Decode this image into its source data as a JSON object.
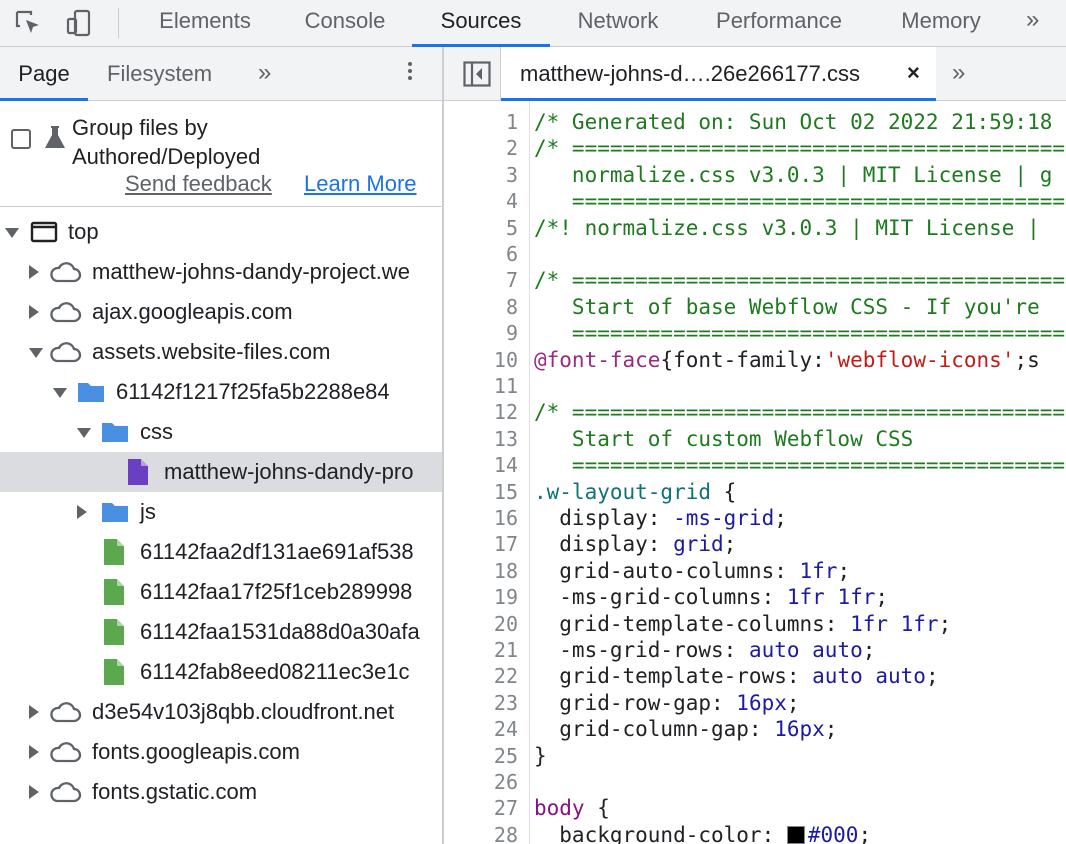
{
  "toolbar": {
    "tabs": [
      "Elements",
      "Console",
      "Sources",
      "Network",
      "Performance",
      "Memory"
    ],
    "active_tab": "Sources",
    "overflow": "»"
  },
  "navigator": {
    "tabs": [
      "Page",
      "Filesystem"
    ],
    "active_tab": "Page",
    "overflow": "»",
    "group_files": {
      "checked": false,
      "label_line1": "Group files by",
      "label_line2": "Authored/Deployed",
      "send_feedback": "Send feedback",
      "learn_more": "Learn More"
    },
    "tree": [
      {
        "label": "top",
        "icon": "frame-icon",
        "arrow": "down",
        "indent": 0
      },
      {
        "label": "matthew-johns-dandy-project.we",
        "icon": "cloud-icon",
        "arrow": "right",
        "indent": 1
      },
      {
        "label": "ajax.googleapis.com",
        "icon": "cloud-icon",
        "arrow": "right",
        "indent": 1
      },
      {
        "label": "assets.website-files.com",
        "icon": "cloud-icon",
        "arrow": "down",
        "indent": 1
      },
      {
        "label": "61142f1217f25fa5b2288e84",
        "icon": "folder-icon",
        "arrow": "down",
        "indent": 2
      },
      {
        "label": "css",
        "icon": "folder-icon",
        "arrow": "down",
        "indent": 3
      },
      {
        "label": "matthew-johns-dandy-pro",
        "icon": "css-file-icon",
        "arrow": "none",
        "indent": 4,
        "selected": true
      },
      {
        "label": "js",
        "icon": "folder-icon",
        "arrow": "right",
        "indent": 3
      },
      {
        "label": "61142faa2df131ae691af538",
        "icon": "js-file-icon",
        "arrow": "none",
        "indent": 3
      },
      {
        "label": "61142faa17f25f1ceb289998",
        "icon": "js-file-icon",
        "arrow": "none",
        "indent": 3
      },
      {
        "label": "61142faa1531da88d0a30afa",
        "icon": "js-file-icon",
        "arrow": "none",
        "indent": 3
      },
      {
        "label": "61142fab8eed08211ec3e1c",
        "icon": "js-file-icon",
        "arrow": "none",
        "indent": 3
      },
      {
        "label": "d3e54v103j8qbb.cloudfront.net",
        "icon": "cloud-icon",
        "arrow": "right",
        "indent": 1
      },
      {
        "label": "fonts.googleapis.com",
        "icon": "cloud-icon",
        "arrow": "right",
        "indent": 1
      },
      {
        "label": "fonts.gstatic.com",
        "icon": "cloud-icon",
        "arrow": "right",
        "indent": 1
      }
    ]
  },
  "editor": {
    "file_tab": "matthew-johns-d….26e266177.css",
    "close": "×",
    "overflow": "»",
    "lines": [
      {
        "n": "1",
        "parts": [
          [
            "c-comment",
            "/* Generated on: Sun Oct 02 2022 21:59:18"
          ]
        ]
      },
      {
        "n": "2",
        "parts": [
          [
            "c-comment",
            "/* =========================================="
          ]
        ]
      },
      {
        "n": "3",
        "parts": [
          [
            "c-comment",
            "   normalize.css v3.0.3 | MIT License | g"
          ]
        ]
      },
      {
        "n": "4",
        "parts": [
          [
            "c-comment",
            "   =========================================="
          ]
        ]
      },
      {
        "n": "5",
        "parts": [
          [
            "c-comment",
            "/*! normalize.css v3.0.3 | MIT License |"
          ]
        ]
      },
      {
        "n": "6",
        "parts": []
      },
      {
        "n": "7",
        "parts": [
          [
            "c-comment",
            "/* =========================================="
          ]
        ]
      },
      {
        "n": "8",
        "parts": [
          [
            "c-comment",
            "   Start of base Webflow CSS - If you're"
          ]
        ]
      },
      {
        "n": "9",
        "parts": [
          [
            "c-comment",
            "   =========================================="
          ]
        ]
      },
      {
        "n": "10",
        "parts": [
          [
            "c-at",
            "@font-face"
          ],
          [
            "c-punc",
            "{font-family:"
          ],
          [
            "c-str",
            "'webflow-icons'"
          ],
          [
            "c-punc",
            ";s"
          ]
        ]
      },
      {
        "n": "11",
        "parts": []
      },
      {
        "n": "12",
        "parts": [
          [
            "c-comment",
            "/* =========================================="
          ]
        ]
      },
      {
        "n": "13",
        "parts": [
          [
            "c-comment",
            "   Start of custom Webflow CSS"
          ]
        ]
      },
      {
        "n": "14",
        "parts": [
          [
            "c-comment",
            "   =========================================="
          ]
        ]
      },
      {
        "n": "15",
        "parts": [
          [
            "c-sel",
            ".w-layout-grid"
          ],
          [
            "c-punc",
            " {"
          ]
        ]
      },
      {
        "n": "16",
        "parts": [
          [
            "c-prop",
            "  display: "
          ],
          [
            "c-val",
            "-ms-grid"
          ],
          [
            "c-punc",
            ";"
          ]
        ]
      },
      {
        "n": "17",
        "parts": [
          [
            "c-prop",
            "  display: "
          ],
          [
            "c-val",
            "grid"
          ],
          [
            "c-punc",
            ";"
          ]
        ]
      },
      {
        "n": "18",
        "parts": [
          [
            "c-prop",
            "  grid-auto-columns: "
          ],
          [
            "c-val",
            "1fr"
          ],
          [
            "c-punc",
            ";"
          ]
        ]
      },
      {
        "n": "19",
        "parts": [
          [
            "c-prop",
            "  -ms-grid-columns: "
          ],
          [
            "c-val",
            "1fr 1fr"
          ],
          [
            "c-punc",
            ";"
          ]
        ]
      },
      {
        "n": "20",
        "parts": [
          [
            "c-prop",
            "  grid-template-columns: "
          ],
          [
            "c-val",
            "1fr 1fr"
          ],
          [
            "c-punc",
            ";"
          ]
        ]
      },
      {
        "n": "21",
        "parts": [
          [
            "c-prop",
            "  -ms-grid-rows: "
          ],
          [
            "c-val",
            "auto auto"
          ],
          [
            "c-punc",
            ";"
          ]
        ]
      },
      {
        "n": "22",
        "parts": [
          [
            "c-prop",
            "  grid-template-rows: "
          ],
          [
            "c-val",
            "auto auto"
          ],
          [
            "c-punc",
            ";"
          ]
        ]
      },
      {
        "n": "23",
        "parts": [
          [
            "c-prop",
            "  grid-row-gap: "
          ],
          [
            "c-val",
            "16px"
          ],
          [
            "c-punc",
            ";"
          ]
        ]
      },
      {
        "n": "24",
        "parts": [
          [
            "c-prop",
            "  grid-column-gap: "
          ],
          [
            "c-val",
            "16px"
          ],
          [
            "c-punc",
            ";"
          ]
        ]
      },
      {
        "n": "25",
        "parts": [
          [
            "c-punc",
            "}"
          ]
        ]
      },
      {
        "n": "26",
        "parts": []
      },
      {
        "n": "27",
        "parts": [
          [
            "c-kw",
            "body"
          ],
          [
            "c-punc",
            " {"
          ]
        ]
      },
      {
        "n": "28",
        "parts": [
          [
            "c-prop",
            "  background-color: "
          ],
          [
            "swatch",
            ""
          ],
          [
            "c-val",
            "#000"
          ],
          [
            "c-punc",
            ";"
          ]
        ]
      }
    ]
  },
  "colors": {
    "accent": "#1a73e8",
    "folder": "#4a90e2",
    "css_file": "#6a3fc2",
    "js_file": "#5ba84e"
  }
}
